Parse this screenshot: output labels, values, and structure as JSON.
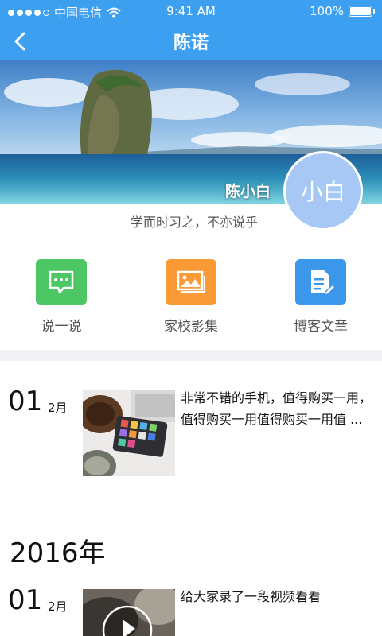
{
  "status": {
    "carrier": "中国电信",
    "time": "9:41 AM",
    "battery": "100%"
  },
  "nav": {
    "title": "陈诺"
  },
  "profile": {
    "name": "陈小白",
    "avatar_text": "小白",
    "motto": "学而时习之，不亦说乎"
  },
  "actions": [
    {
      "label": "说一说",
      "icon": "chat-bubble-icon",
      "color": "#4cc764"
    },
    {
      "label": "家校影集",
      "icon": "photo-album-icon",
      "color": "#f99a36"
    },
    {
      "label": "博客文章",
      "icon": "edit-document-icon",
      "color": "#3b97ea"
    }
  ],
  "timeline": {
    "entries": [
      {
        "day": "01",
        "month": "2月",
        "text": "非常不错的手机，值得购买一用，值得购买一用值得购买一用值 ..."
      },
      {
        "day": "01",
        "month": "2月",
        "text": "给大家录了一段视频看看"
      }
    ],
    "year_header": "2016年"
  },
  "colors": {
    "nav_bg": "#3d9ff0",
    "avatar_bg": "#a7c8f4",
    "separator": "#f2f2f4"
  }
}
